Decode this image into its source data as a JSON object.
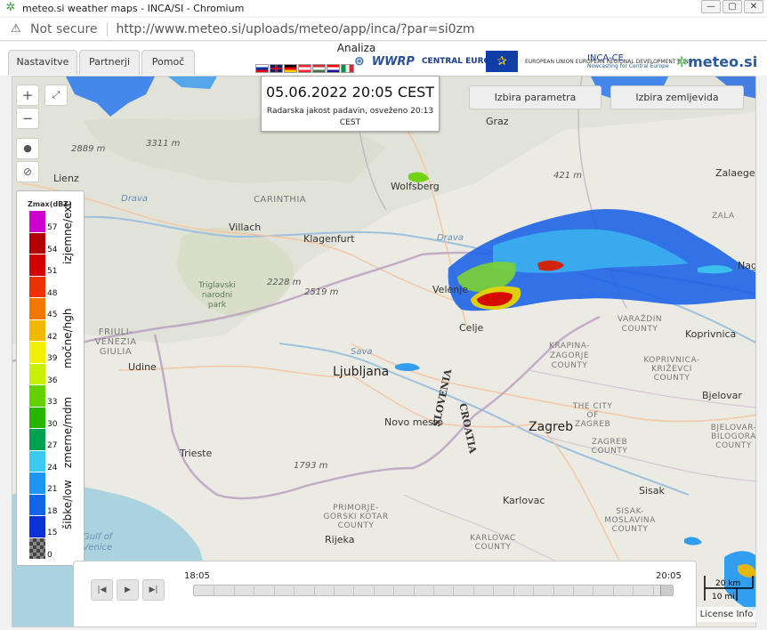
{
  "window": {
    "title": "meteo.si weather maps - INCA/SI - Chromium",
    "controls": [
      "—",
      "▢",
      "✕"
    ]
  },
  "address_bar": {
    "security": "Not secure",
    "url": "http://www.meteo.si/uploads/meteo/app/inca/?par=si0zm"
  },
  "tabs": [
    "Nastavitve",
    "Partnerji",
    "Pomoč"
  ],
  "logos": {
    "wwrp": "WWRP",
    "central_europe": "CENTRAL EUROPE",
    "eu_fund": "EUROPEAN UNION EUROPEAN REGIONAL DEVELOPMENT FUND",
    "inca_ce": "INCA-CE",
    "inca_ce_sub": "Nowcasting for Central Europe",
    "meteo": "meteo.si"
  },
  "timestamp": {
    "datetime": "05.06.2022 20:05 CEST",
    "subtitle": "Radarska jakost padavin, osveženo 20:13 CEST"
  },
  "buttons": {
    "parameter": "Izbira parametra",
    "map": "Izbira zemljevida"
  },
  "legend": {
    "title": "Zmax(dBZ)",
    "values": [
      "57",
      "54",
      "51",
      "48",
      "45",
      "42",
      "39",
      "36",
      "33",
      "30",
      "27",
      "24",
      "21",
      "18",
      "15",
      "0"
    ],
    "colors": [
      "#cc00cc",
      "#b00000",
      "#d40000",
      "#f03000",
      "#f07800",
      "#f0b800",
      "#f0f000",
      "#c8f000",
      "#64d200",
      "#28b400",
      "#00a050",
      "#3cc8f0",
      "#1e96f0",
      "#1464e6",
      "#0a32d2",
      "#555555"
    ],
    "categories": [
      "izjemne/ext",
      "močne/hgh",
      "zmerne/mdm",
      "šibke/low"
    ]
  },
  "map_labels": {
    "cities": [
      "Lienz",
      "Wolfsberg",
      "Villach",
      "Klagenfurt",
      "Graz",
      "Zalaeger",
      "Velenje",
      "Celje",
      "Ljubljana",
      "Udine",
      "Trieste",
      "Novo mesto",
      "Zagreb",
      "Koprivnica",
      "Bjelovar",
      "Sisak",
      "Karlovac",
      "Rijeka",
      "Nagy"
    ],
    "capitals": [
      "Ljubljana",
      "Zagreb"
    ],
    "regions": [
      "CARINTHIA",
      "FRIULI-VENEZIA GIULIA",
      "KRAPINA-ZAGORJE COUNTY",
      "VARAŽDIN COUNTY",
      "KOPRIVNICA-KRIŽEVCI COUNTY",
      "THE CITY OF ZAGREB",
      "ZAGREB COUNTY",
      "BJELOVAR-BILOGORA COUNTY",
      "PRIMORJE-GORSKI KOTAR COUNTY",
      "KARLOVAC COUNTY",
      "SISAK-MOSLAVINA COUNTY",
      "ZALA"
    ],
    "countries": [
      "SLOVENIA",
      "CROATIA"
    ],
    "water": [
      "Drava",
      "Sava",
      "Gulf of Venice"
    ],
    "elevations": [
      "2889 m",
      "3311 m",
      "421 m",
      "2228 m",
      "2519 m",
      "1793 m"
    ],
    "park": "Triglavski narodni park"
  },
  "timeline": {
    "start": "18:05",
    "end": "20:05",
    "mode": "Analiza",
    "progress": 1.0,
    "segments": 24
  },
  "scale": {
    "km": "20 km",
    "mi": "10 mi"
  },
  "license": "License Info"
}
